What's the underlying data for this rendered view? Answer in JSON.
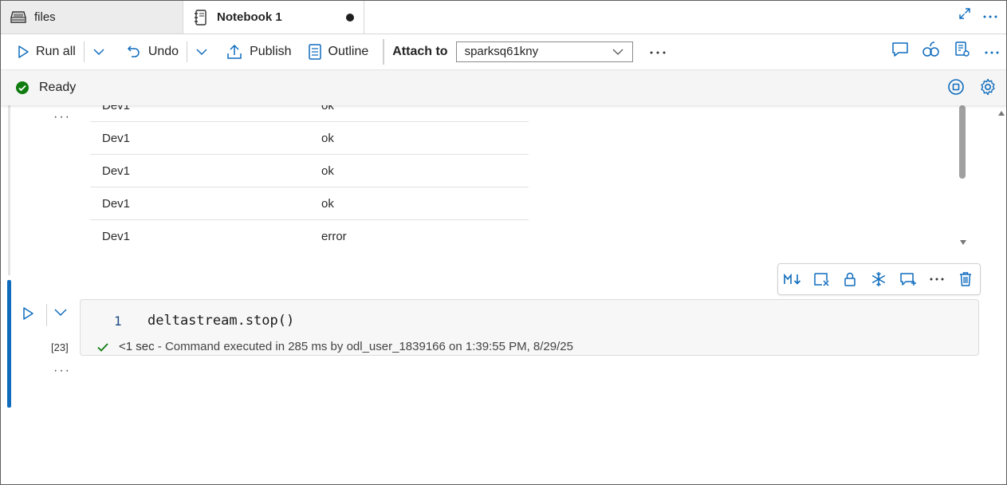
{
  "tabs": [
    {
      "label": "files",
      "icon": "database-icon"
    },
    {
      "label": "Notebook 1",
      "icon": "notebook-icon",
      "dirty": true
    }
  ],
  "toolbar": {
    "run_all": "Run all",
    "undo": "Undo",
    "publish": "Publish",
    "outline": "Outline",
    "attach_to": "Attach to",
    "attach_value": "sparksq61kny"
  },
  "status": {
    "text": "Ready"
  },
  "output_table": {
    "rows": [
      [
        "Dev1",
        "ok"
      ],
      [
        "Dev1",
        "ok"
      ],
      [
        "Dev1",
        "ok"
      ],
      [
        "Dev1",
        "ok"
      ],
      [
        "Dev1",
        "error"
      ]
    ]
  },
  "cell": {
    "line_number": "1",
    "code": "deltastream.stop()",
    "exec_count": "[23]",
    "duration": "<1 sec",
    "exec_message": " - Command executed in 285 ms by odl_user_1839166 on 1:39:55 PM, 8/29/25"
  },
  "colors": {
    "accent": "#0f6cbd",
    "success": "#107c10"
  }
}
